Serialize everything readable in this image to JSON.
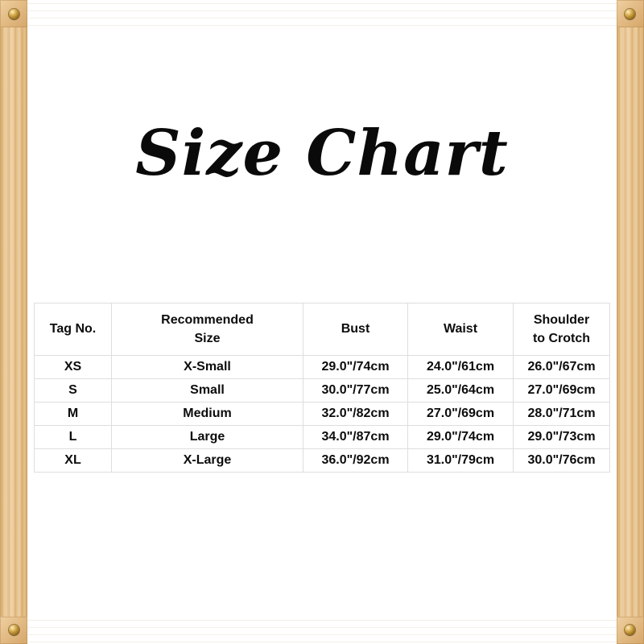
{
  "frame": {
    "wood_color": "#e6c390",
    "wood_color_dark": "#c2914d",
    "screw_color": "#c89a36",
    "screws": [
      {
        "name": "screw-top-left"
      },
      {
        "name": "screw-top-right"
      },
      {
        "name": "screw-bottom-left"
      },
      {
        "name": "screw-bottom-right"
      }
    ]
  },
  "canvas": {
    "background": "#ffffff"
  },
  "title": "Size Chart",
  "table": {
    "border_color": "#dedede",
    "text_color": "#0c0c0c",
    "headers": [
      {
        "line1": "Tag No.",
        "line2": ""
      },
      {
        "line1": "Recommended",
        "line2": "Size"
      },
      {
        "line1": "Bust",
        "line2": ""
      },
      {
        "line1": "Waist",
        "line2": ""
      },
      {
        "line1": "Shoulder",
        "line2": "to Crotch"
      }
    ],
    "rows": [
      {
        "tag_no": "XS",
        "recommended_size": "X-Small",
        "bust": "29.0\"/74cm",
        "waist": "24.0\"/61cm",
        "shoulder_to_crotch": "26.0\"/67cm"
      },
      {
        "tag_no": "S",
        "recommended_size": "Small",
        "bust": "30.0\"/77cm",
        "waist": "25.0\"/64cm",
        "shoulder_to_crotch": "27.0\"/69cm"
      },
      {
        "tag_no": "M",
        "recommended_size": "Medium",
        "bust": "32.0\"/82cm",
        "waist": "27.0\"/69cm",
        "shoulder_to_crotch": "28.0\"/71cm"
      },
      {
        "tag_no": "L",
        "recommended_size": "Large",
        "bust": "34.0\"/87cm",
        "waist": "29.0\"/74cm",
        "shoulder_to_crotch": "29.0\"/73cm"
      },
      {
        "tag_no": "XL",
        "recommended_size": "X-Large",
        "bust": "36.0\"/92cm",
        "waist": "31.0\"/79cm",
        "shoulder_to_crotch": "30.0\"/76cm"
      }
    ]
  }
}
